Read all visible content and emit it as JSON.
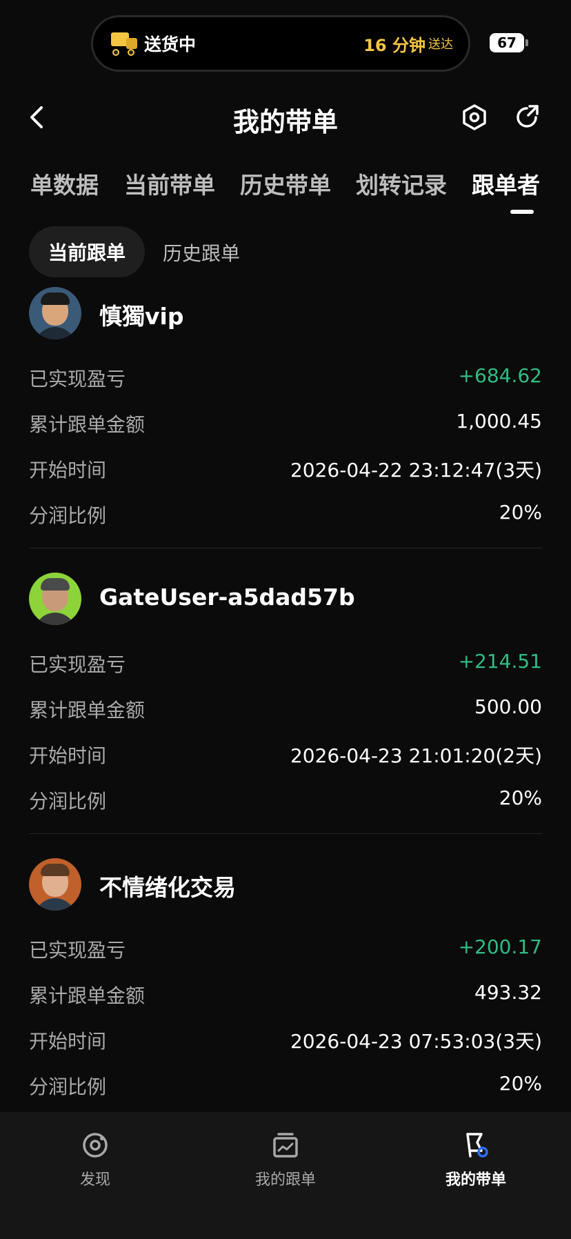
{
  "status_bar": {
    "delivery_status": "送货中",
    "eta": "16 分钟",
    "eta_suffix": "送达",
    "battery": "67"
  },
  "header": {
    "title": "我的带单"
  },
  "tabs": [
    {
      "label": "单数据"
    },
    {
      "label": "当前带单"
    },
    {
      "label": "历史带单"
    },
    {
      "label": "划转记录"
    },
    {
      "label": "跟单者",
      "active": true
    }
  ],
  "subtabs": [
    {
      "label": "当前跟单",
      "active": true
    },
    {
      "label": "历史跟单"
    }
  ],
  "followers": [
    {
      "name": "慎獨vip",
      "rows": [
        {
          "label": "已实现盈亏",
          "value": "+684.62"
        },
        {
          "label": "累计跟单金额",
          "value": "1,000.45"
        },
        {
          "label": "开始时间",
          "value": "2026-04-22 23:12:47(3天)"
        },
        {
          "label": "分润比例",
          "value": "20%"
        }
      ]
    },
    {
      "name": "GateUser-a5dad57b",
      "rows": [
        {
          "label": "已实现盈亏",
          "value": "+214.51"
        },
        {
          "label": "累计跟单金额",
          "value": "500.00"
        },
        {
          "label": "开始时间",
          "value": "2026-04-23 21:01:20(2天)"
        },
        {
          "label": "分润比例",
          "value": "20%"
        }
      ]
    },
    {
      "name": "不情绪化交易",
      "rows": [
        {
          "label": "已实现盈亏",
          "value": "+200.17"
        },
        {
          "label": "累计跟单金额",
          "value": "493.32"
        },
        {
          "label": "开始时间",
          "value": "2026-04-23 07:53:03(3天)"
        },
        {
          "label": "分润比例",
          "value": "20%"
        }
      ]
    }
  ],
  "bottom_nav": [
    {
      "label": "发现",
      "icon": "discover-icon"
    },
    {
      "label": "我的跟单",
      "icon": "chart-box-icon"
    },
    {
      "label": "我的带单",
      "icon": "flag-icon",
      "active": true
    }
  ],
  "colors": {
    "background": "#0b0b0b",
    "profit": "#2fbd85",
    "eta": "#f5c542",
    "muted": "#a9a9a9"
  }
}
